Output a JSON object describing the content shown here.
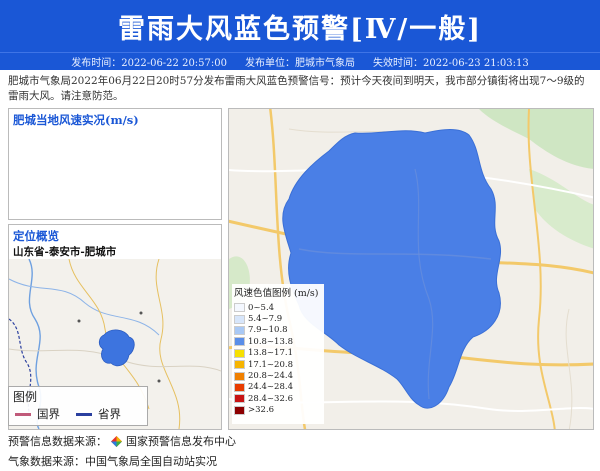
{
  "header": {
    "title": "雷雨大风蓝色预警[Ⅳ/一般]",
    "publish_time": "发布时间：2022-06-22 20:57:00",
    "publish_unit": "发布单位：肥城市气象局",
    "expire_time": "失效时间：2022-06-23 21:03:13"
  },
  "description": "肥城市气象局2022年06月22日20时57分发布雷雨大风蓝色预警信号：预计今天夜间到明天，我市部分镇街将出现7～9级的雷雨大风。请注意防范。",
  "wind_panel": {
    "title": "肥城当地风速实况(m/s)"
  },
  "location_panel": {
    "title": "定位概览",
    "region": "山东省-泰安市-肥城市",
    "legend": {
      "title": "图例",
      "items": [
        {
          "label": "国界",
          "color": "#c05a7a"
        },
        {
          "label": "省界",
          "color": "#2a3f9f"
        }
      ]
    }
  },
  "wind_legend": {
    "title": "风速色值图例 (m/s)",
    "items": [
      {
        "label": "0~5.4",
        "color": "#f4f8ff"
      },
      {
        "label": "5.4~7.9",
        "color": "#d7e6fb"
      },
      {
        "label": "7.9~10.8",
        "color": "#a9c9f5"
      },
      {
        "label": "10.8~13.8",
        "color": "#5a8ee8"
      },
      {
        "label": "13.8~17.1",
        "color": "#f6e000"
      },
      {
        "label": "17.1~20.8",
        "color": "#f6b400"
      },
      {
        "label": "20.8~24.4",
        "color": "#f08000"
      },
      {
        "label": "24.4~28.4",
        "color": "#e83c00"
      },
      {
        "label": "28.4~32.6",
        "color": "#c81414"
      },
      {
        "label": ">32.6",
        "color": "#8c0000"
      }
    ]
  },
  "sources": {
    "warning_source": "预警信息数据来源：",
    "warning_org": "国家预警信息发布中心",
    "weather_source": "气象数据来源：中国气象局全国自动站实况"
  },
  "colors": {
    "brand": "#1a57d6",
    "warning_area": "#4a7fe6"
  }
}
